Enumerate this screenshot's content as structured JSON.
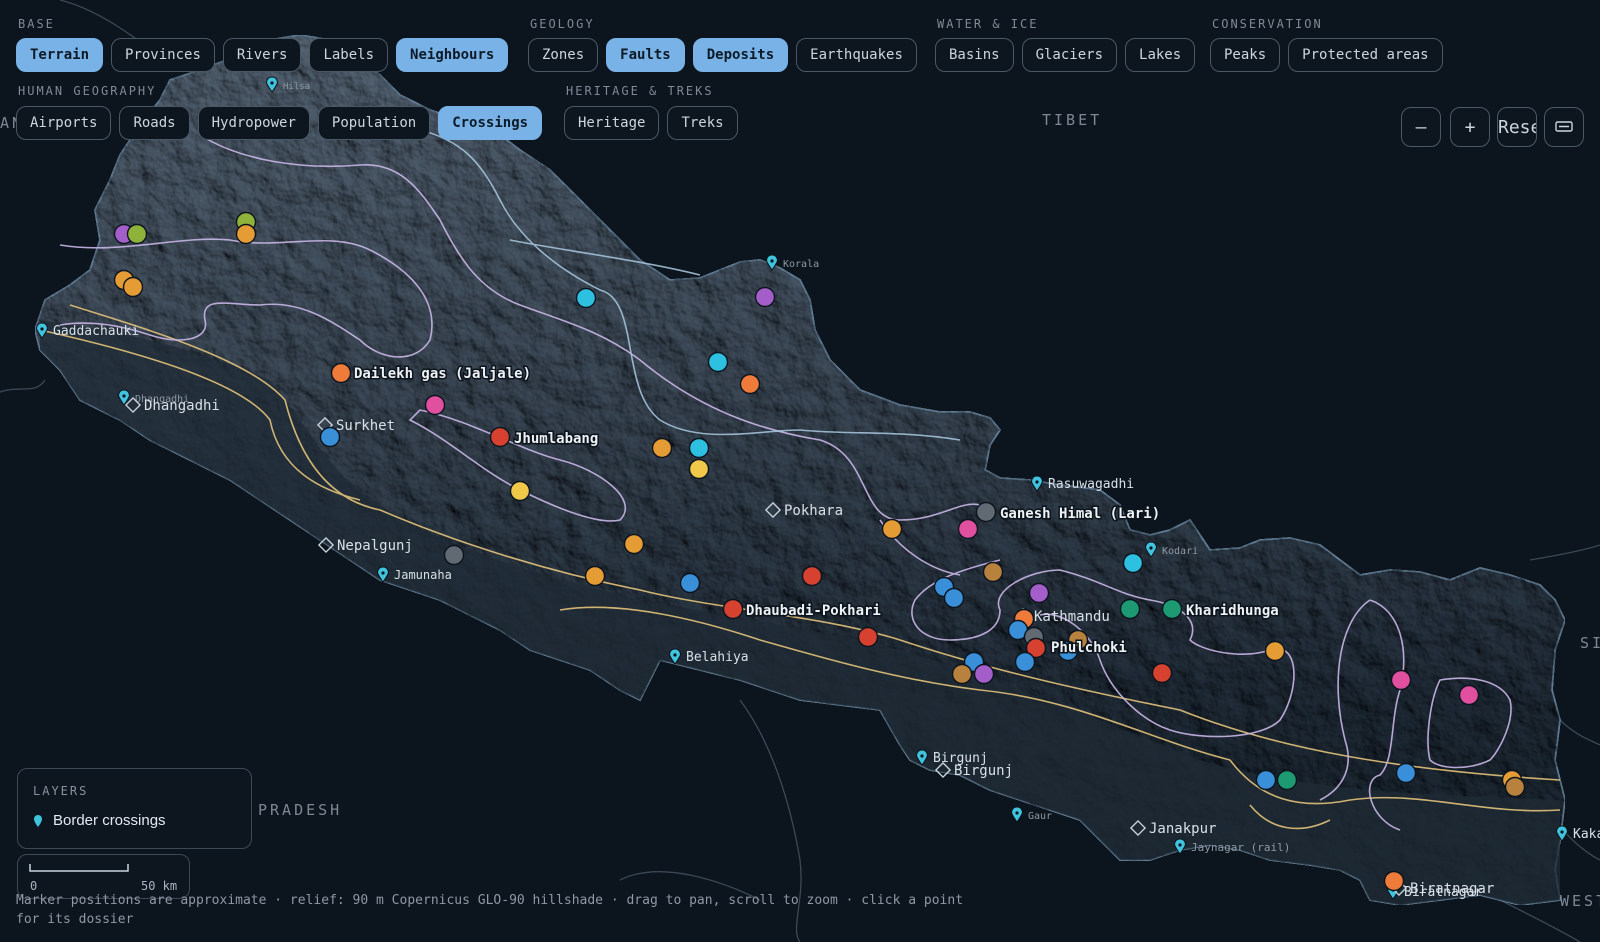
{
  "toolbar": {
    "groups": [
      {
        "label": "BASE",
        "chips": [
          {
            "label": "Terrain",
            "active": true
          },
          {
            "label": "Provinces",
            "active": false
          },
          {
            "label": "Rivers",
            "active": false
          },
          {
            "label": "Labels",
            "active": false
          },
          {
            "label": "Neighbours",
            "active": true
          }
        ]
      },
      {
        "label": "GEOLOGY",
        "chips": [
          {
            "label": "Zones",
            "active": false
          },
          {
            "label": "Faults",
            "active": true
          },
          {
            "label": "Deposits",
            "active": true
          },
          {
            "label": "Earthquakes",
            "active": false
          }
        ]
      },
      {
        "label": "WATER & ICE",
        "chips": [
          {
            "label": "Basins",
            "active": false
          },
          {
            "label": "Glaciers",
            "active": false
          },
          {
            "label": "Lakes",
            "active": false
          }
        ]
      },
      {
        "label": "CONSERVATION",
        "chips": [
          {
            "label": "Peaks",
            "active": false
          },
          {
            "label": "Protected areas",
            "active": false
          }
        ]
      },
      {
        "label": "HUMAN GEOGRAPHY",
        "chips": [
          {
            "label": "Airports",
            "active": false
          },
          {
            "label": "Roads",
            "active": false
          },
          {
            "label": "Hydropower",
            "active": false
          },
          {
            "label": "Population",
            "active": false
          },
          {
            "label": "Crossings",
            "active": true
          }
        ]
      },
      {
        "label": "HERITAGE & TREKS",
        "chips": [
          {
            "label": "Heritage",
            "active": false
          },
          {
            "label": "Treks",
            "active": false
          }
        ]
      }
    ]
  },
  "zoom": {
    "out_label": "–",
    "in_label": "+",
    "reset_label": "Rese",
    "fullscreen_icon": "fullscreen-icon"
  },
  "neighbours": {
    "tibet": "TIBET",
    "pradesh": "PRADESH",
    "si": "SI",
    "west": "WEST",
    "left_edge": "AN"
  },
  "colors": {
    "accent": "#79b2e6",
    "fault": "#e2c27a",
    "river": "#c9b6e6",
    "crossing": "#40c4de",
    "deposit_orange": "#ee7b3a",
    "deposit_amber": "#e59c35",
    "deposit_red": "#d7412f",
    "deposit_blue": "#3a8fd9",
    "deposit_cyan": "#2ec0e0",
    "deposit_yellow": "#f1c94a",
    "deposit_magenta": "#e0509f",
    "deposit_purple": "#a35ec9",
    "deposit_green": "#1d9a72",
    "deposit_olive": "#8fb23b",
    "deposit_gray": "#616a73",
    "deposit_brown": "#b8823e"
  },
  "crossings": [
    {
      "name": "Hilsa"
    },
    {
      "name": "Korala"
    },
    {
      "name": "Gaddachauki"
    },
    {
      "name": "Dhangadhi"
    },
    {
      "name": "Jamunaha"
    },
    {
      "name": "Belahiya"
    },
    {
      "name": "Rasuwagadhi"
    },
    {
      "name": "Kodari"
    },
    {
      "name": "Birgunj"
    },
    {
      "name": "Gaur"
    },
    {
      "name": "Jaynagar (rail)"
    },
    {
      "name": "Biratnagar"
    },
    {
      "name": "Kakarbhitta"
    }
  ],
  "cities": [
    {
      "name": "Dhangadhi"
    },
    {
      "name": "Surkhet"
    },
    {
      "name": "Nepalgunj"
    },
    {
      "name": "Pokhara"
    },
    {
      "name": "Kathmandu"
    },
    {
      "name": "Birgunj"
    },
    {
      "name": "Janakpur"
    },
    {
      "name": "Biratnagar"
    }
  ],
  "deposit_labels": {
    "dailekh": "Dailekh gas (Jaljale)",
    "jhumlabang": "Jhumlabang",
    "dhaubadi": "Dhaubadi-Pokhari",
    "ganesh": "Ganesh Himal (Lari)",
    "kharidhunga": "Kharidhunga",
    "phulchoki": "Phulchoki"
  },
  "deposits": [
    {
      "color": "purple"
    },
    {
      "color": "olive"
    },
    {
      "color": "olive"
    },
    {
      "color": "amber"
    },
    {
      "color": "amber"
    },
    {
      "color": "amber"
    },
    {
      "color": "cyan"
    },
    {
      "color": "purple"
    },
    {
      "color": "orange"
    },
    {
      "color": "magenta"
    },
    {
      "color": "red"
    },
    {
      "color": "blue"
    },
    {
      "color": "cyan"
    },
    {
      "color": "orange"
    },
    {
      "color": "amber"
    },
    {
      "color": "cyan"
    },
    {
      "color": "yellow"
    },
    {
      "color": "yellow"
    },
    {
      "color": "gray"
    },
    {
      "color": "amber"
    },
    {
      "color": "amber"
    },
    {
      "color": "blue"
    },
    {
      "color": "red"
    },
    {
      "color": "red"
    },
    {
      "color": "red"
    },
    {
      "color": "amber"
    },
    {
      "color": "magenta"
    },
    {
      "color": "gray"
    },
    {
      "color": "cyan"
    },
    {
      "color": "blue"
    },
    {
      "color": "blue"
    },
    {
      "color": "brown"
    },
    {
      "color": "purple"
    },
    {
      "color": "orange"
    },
    {
      "color": "blue"
    },
    {
      "color": "gray"
    },
    {
      "color": "red"
    },
    {
      "color": "brown"
    },
    {
      "color": "blue"
    },
    {
      "color": "blue"
    },
    {
      "color": "blue"
    },
    {
      "color": "brown"
    },
    {
      "color": "purple"
    },
    {
      "color": "green"
    },
    {
      "color": "green"
    },
    {
      "color": "red"
    },
    {
      "color": "amber"
    },
    {
      "color": "magenta"
    },
    {
      "color": "magenta"
    },
    {
      "color": "blue"
    },
    {
      "color": "green"
    },
    {
      "color": "blue"
    },
    {
      "color": "amber"
    },
    {
      "color": "brown"
    },
    {
      "color": "orange"
    }
  ],
  "legend": {
    "title": "LAYERS",
    "item": "Border crossings"
  },
  "scale": {
    "zero": "0",
    "distance": "50 km"
  },
  "footer": "Marker positions are approximate · relief: 90 m Copernicus GLO-90 hillshade · drag to pan, scroll to zoom · click a point for its dossier"
}
